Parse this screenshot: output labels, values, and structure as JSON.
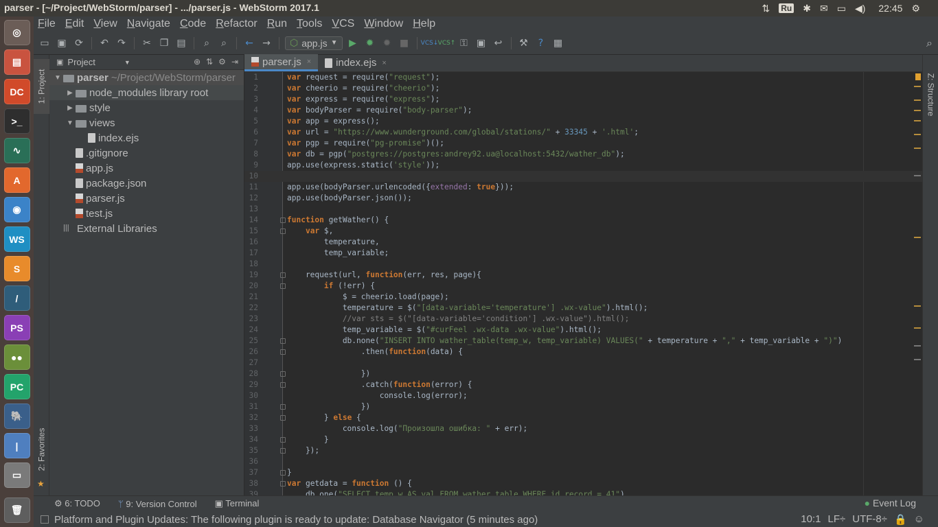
{
  "window": {
    "title": "parser - [~/Project/WebStorm/parser] - .../parser.js - WebStorm 2017.1",
    "tray_lang": "Ru",
    "clock": "22:45"
  },
  "menu": [
    "File",
    "Edit",
    "View",
    "Navigate",
    "Code",
    "Refactor",
    "Run",
    "Tools",
    "VCS",
    "Window",
    "Help"
  ],
  "toolbar": {
    "run_config": "app.js"
  },
  "left_strip": {
    "project_tab": "1: Project",
    "favorites_tab": "2: Favorites"
  },
  "right_strip": {
    "structure_tab": "Z: Structure"
  },
  "project_panel": {
    "header": "Project",
    "tree": [
      {
        "label": "parser",
        "extra": "~/Project/WebStorm/parser",
        "indent": 0,
        "arrow": "▼",
        "icon": "folder"
      },
      {
        "label": "node_modules",
        "extra": "library root",
        "indent": 1,
        "arrow": "▶",
        "icon": "folder"
      },
      {
        "label": "style",
        "extra": "",
        "indent": 1,
        "arrow": "▶",
        "icon": "folder"
      },
      {
        "label": "views",
        "extra": "",
        "indent": 1,
        "arrow": "▼",
        "icon": "folder"
      },
      {
        "label": "index.ejs",
        "extra": "",
        "indent": 2,
        "arrow": "",
        "icon": "file"
      },
      {
        "label": ".gitignore",
        "extra": "",
        "indent": 1,
        "arrow": "",
        "icon": "file"
      },
      {
        "label": "app.js",
        "extra": "",
        "indent": 1,
        "arrow": "",
        "icon": "js"
      },
      {
        "label": "package.json",
        "extra": "",
        "indent": 1,
        "arrow": "",
        "icon": "file"
      },
      {
        "label": "parser.js",
        "extra": "",
        "indent": 1,
        "arrow": "",
        "icon": "js"
      },
      {
        "label": "test.js",
        "extra": "",
        "indent": 1,
        "arrow": "",
        "icon": "js"
      },
      {
        "label": "External Libraries",
        "extra": "",
        "indent": 0,
        "arrow": "",
        "icon": "lib"
      }
    ]
  },
  "editor_tabs": [
    {
      "label": "parser.js",
      "active": true
    },
    {
      "label": "index.ejs",
      "active": false
    }
  ],
  "code_lines": [
    "var request = require(\"request\");",
    "var cheerio = require(\"cheerio\");",
    "var express = require(\"express\");",
    "var bodyParser = require(\"body-parser\");",
    "var app = express();",
    "var url = \"https://www.wunderground.com/global/stations/\" + 33345 + '.html';",
    "var pgp = require(\"pg-promise\")();",
    "var db = pgp(\"postgres://postgres:andrey92.ua@localhost:5432/wather_db\");",
    "app.use(express.static('style'));",
    "",
    "app.use(bodyParser.urlencoded({extended: true}));",
    "app.use(bodyParser.json());",
    "",
    "function getWather() {",
    "    var $,",
    "        temperature,",
    "        temp_variable;",
    "",
    "    request(url, function(err, res, page){",
    "        if (!err) {",
    "            $ = cheerio.load(page);",
    "            temperature = $(\"[data-variable='temperature'] .wx-value\").html();",
    "            //var sts = $(\"[data-variable='condition'] .wx-value\").html();",
    "            temp_variable = $(\"#curFeel .wx-data .wx-value\").html();",
    "            db.none(\"INSERT INTO wather_table(temp_w, temp_variable) VALUES(\" + temperature + \",\" + temp_variable + \")\")",
    "                .then(function(data) {",
    "",
    "                })",
    "                .catch(function(error) {",
    "                    console.log(error);",
    "                })",
    "        } else {",
    "            console.log(\"Произошла ошибка: \" + err);",
    "        }",
    "    });",
    "",
    "}",
    "var getdata = function () {",
    "    db.one(\"SELECT temp_w AS val FROM wather_table WHERE id_record = 41\")"
  ],
  "bottom_tools": [
    {
      "label": "6: TODO",
      "icon": "todo-icon"
    },
    {
      "label": "9: Version Control",
      "icon": "vcs-icon"
    },
    {
      "label": "Terminal",
      "icon": "terminal-icon"
    }
  ],
  "event_log": "Event Log",
  "status": {
    "message": "Platform and Plugin Updates: The following plugin is ready to update: Database Navigator (5 minutes ago)",
    "position": "10:1",
    "line_sep": "LF÷",
    "encoding": "UTF-8÷"
  },
  "colors": {
    "accent": "#4a88c7",
    "keyword": "#cc7832",
    "string": "#6a8759",
    "number": "#6897bb",
    "background": "#2b2b2b"
  }
}
